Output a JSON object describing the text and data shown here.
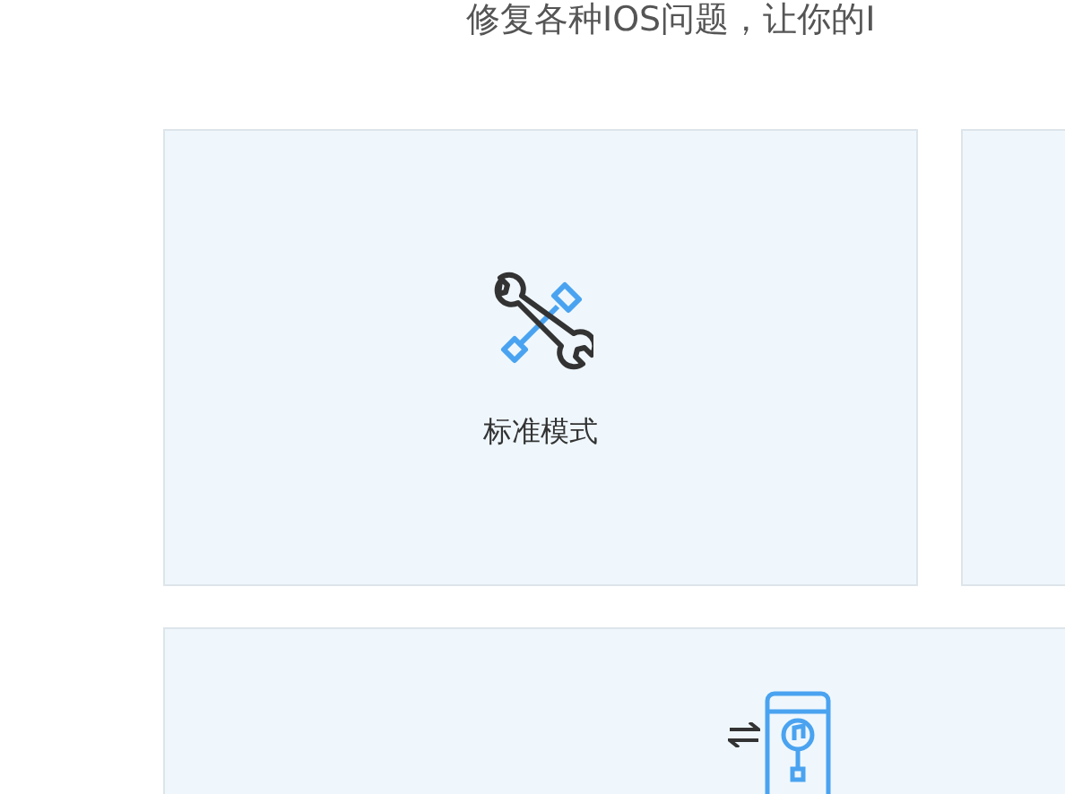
{
  "subtitle": "修复各种IOS问题，让你的I",
  "mode_cards": [
    {
      "label": "标准模式"
    }
  ]
}
